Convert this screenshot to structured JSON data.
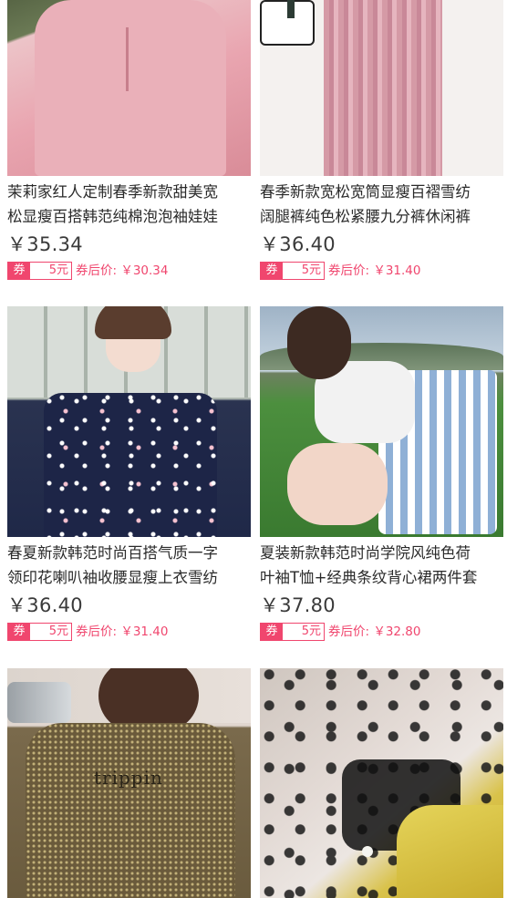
{
  "products": [
    {
      "title_line1": "茉莉家红人定制春季新款甜美宽",
      "title_line2": "松显瘦百搭韩范纯棉泡泡袖娃娃",
      "price": "￥35.34",
      "coupon_tag": "券",
      "coupon_amount": "5元",
      "after_coupon": "券后价: ￥30.34",
      "image_alt": "pink blouse photo"
    },
    {
      "title_line1": "春季新款宽松宽筒显瘦百褶雪纺",
      "title_line2": "阔腿裤纯色松紧腰九分裤休闲裤",
      "price": "￥36.40",
      "coupon_tag": "券",
      "coupon_amount": "5元",
      "after_coupon": "券后价: ￥31.40",
      "image_alt": "pink pleated pants photo"
    },
    {
      "title_line1": "春夏新款韩范时尚百搭气质一字",
      "title_line2": "领印花喇叭袖收腰显瘦上衣雪纺",
      "price": "￥36.40",
      "coupon_tag": "券",
      "coupon_amount": "5元",
      "after_coupon": "券后价: ￥31.40",
      "image_alt": "navy floral off-shoulder top photo"
    },
    {
      "title_line1": "夏装新款韩范时尚学院风纯色荷",
      "title_line2": "叶袖T恤+经典条纹背心裙两件套",
      "price": "￥37.80",
      "coupon_tag": "券",
      "coupon_amount": "5元",
      "after_coupon": "券后价: ￥32.80",
      "image_alt": "striped dress set photo"
    },
    {
      "title_line1": "",
      "title_line2": "",
      "price": "",
      "coupon_tag": "",
      "coupon_amount": "",
      "after_coupon": "",
      "image_alt": "olive sequin t-shirt photo",
      "shirt_text": "trippin"
    },
    {
      "title_line1": "",
      "title_line2": "",
      "price": "",
      "coupon_tag": "",
      "coupon_amount": "",
      "after_coupon": "",
      "image_alt": "star mesh top photo"
    }
  ],
  "colors": {
    "accent": "#f0466e",
    "text": "#2a2a2a"
  }
}
